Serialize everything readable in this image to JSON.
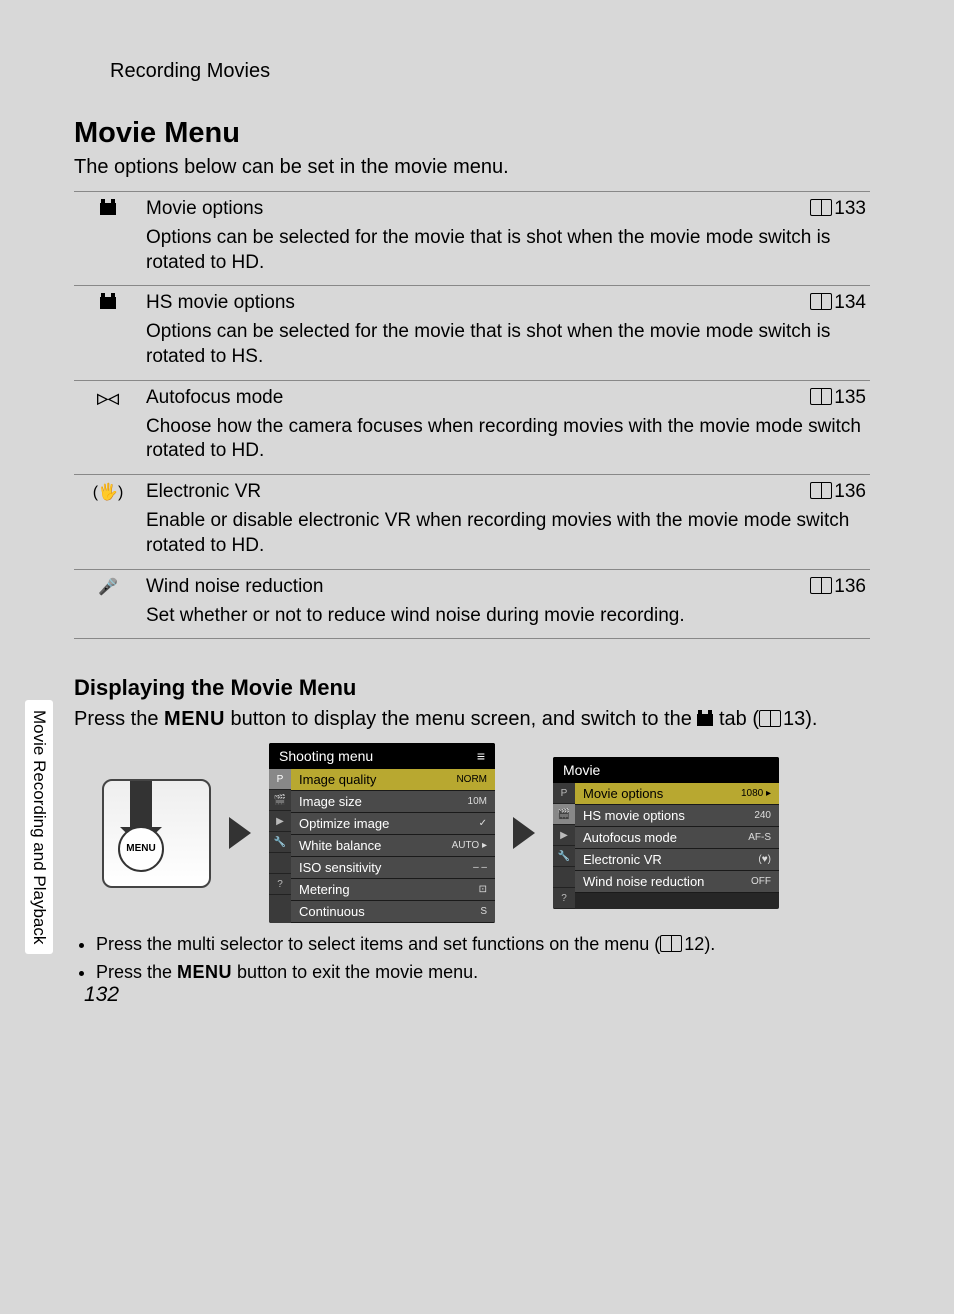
{
  "sidebar_tab": "Movie Recording and Playback",
  "section_path": "Recording Movies",
  "heading": "Movie Menu",
  "intro": "The options below can be set in the movie menu.",
  "items": [
    {
      "title": "Movie options",
      "page": "133",
      "desc": "Options can be selected for the movie that is shot when the movie mode switch is rotated to HD."
    },
    {
      "title": "HS movie options",
      "page": "134",
      "desc": "Options can be selected for the movie that is shot when the movie mode switch is rotated to HS."
    },
    {
      "title": "Autofocus mode",
      "page": "135",
      "desc": "Choose how the camera focuses when recording movies with the movie mode switch rotated to HD."
    },
    {
      "title": "Electronic VR",
      "page": "136",
      "desc": "Enable or disable electronic VR when recording movies with the movie mode switch rotated to HD."
    },
    {
      "title": "Wind noise reduction",
      "page": "136",
      "desc": "Set whether or not to reduce wind noise during movie recording."
    }
  ],
  "subheading": "Displaying the Movie Menu",
  "display_line_pre": "Press the ",
  "display_line_menu": "MENU",
  "display_line_mid": " button to display the menu screen, and switch to the ",
  "display_line_post": " tab (",
  "display_line_page": "13",
  "display_line_end": ").",
  "camera_menu_label": "MENU",
  "screen1": {
    "title": "Shooting menu",
    "items": [
      {
        "label": "Image quality",
        "val": "NORM"
      },
      {
        "label": "Image size",
        "val": "10M"
      },
      {
        "label": "Optimize image",
        "val": "✓"
      },
      {
        "label": "White balance",
        "val": "AUTO ▸"
      },
      {
        "label": "ISO sensitivity",
        "val": "– –"
      },
      {
        "label": "Metering",
        "val": "⊡"
      },
      {
        "label": "Continuous",
        "val": "S"
      }
    ]
  },
  "screen2": {
    "title": "Movie",
    "items": [
      {
        "label": "Movie options",
        "val": "1080 ▸"
      },
      {
        "label": "HS movie options",
        "val": "240"
      },
      {
        "label": "Autofocus mode",
        "val": "AF-S"
      },
      {
        "label": "Electronic VR",
        "val": "(♥)"
      },
      {
        "label": "Wind noise reduction",
        "val": "OFF"
      }
    ]
  },
  "bullets": [
    {
      "pre": "Press the multi selector to select items and set functions on the menu (",
      "page": "12",
      "post": ")."
    },
    {
      "pre": "Press the ",
      "menu": "MENU",
      "post2": " button to exit the movie menu."
    }
  ],
  "page_number": "132"
}
